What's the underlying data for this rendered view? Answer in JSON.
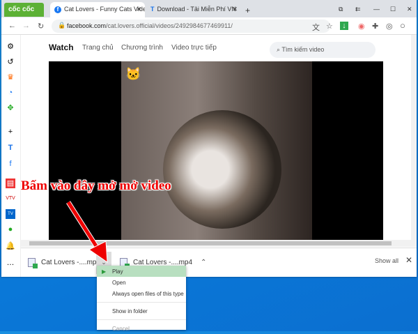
{
  "browser": {
    "logo": "cốc cốc",
    "tabs": [
      {
        "title": "Cat Lovers - Funny Cats Vide",
        "icon": "facebook-icon"
      },
      {
        "title": "Download - Tải Miễn Phí VN",
        "icon": "t-icon"
      }
    ],
    "url_host": "facebook.com",
    "url_path": "/cat.lovers.official/videos/2492984677469911/"
  },
  "facebook": {
    "nav": [
      "Watch",
      "Trang chủ",
      "Chương trình",
      "Video trực tiếp"
    ],
    "search_placeholder": "Tìm kiếm video"
  },
  "downloads": {
    "items": [
      "Cat Lovers -....mp4",
      "Cat Lovers -....mp4"
    ],
    "show_all": "Show all"
  },
  "context_menu": {
    "items": [
      "Play",
      "Open",
      "Always open files of this type",
      "Show in folder",
      "Cancel"
    ],
    "highlighted": "Play"
  },
  "annotation": "Bấm vào đây mở mở video",
  "colors": {
    "accent_green": "#5cb135",
    "annotation_red": "#e00000",
    "menu_highlight": "#b8dfc0"
  }
}
